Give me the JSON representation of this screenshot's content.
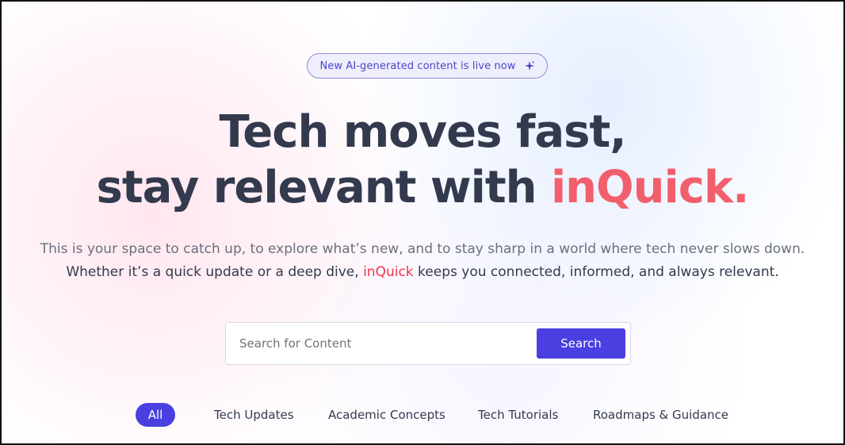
{
  "announcement": {
    "text": "New AI-generated content is live now",
    "icon": "sparkle-icon"
  },
  "hero": {
    "headline_line1": "Tech moves fast,",
    "headline_line2_prefix": "stay relevant with ",
    "headline_brand": "inQuick.",
    "description_line1": "This is your space to catch up, to explore what’s new, and to stay sharp in a world where tech never slows down.",
    "description_line2_prefix": "Whether it’s a quick update or a deep dive, ",
    "description_brand": "inQuick",
    "description_line2_suffix": " keeps you connected, informed, and always relevant."
  },
  "search": {
    "placeholder": "Search for Content",
    "button_label": "Search"
  },
  "categories": {
    "items": [
      {
        "label": "All",
        "active": true
      },
      {
        "label": "Tech Updates",
        "active": false
      },
      {
        "label": "Academic Concepts",
        "active": false
      },
      {
        "label": "Tech Tutorials",
        "active": false
      },
      {
        "label": "Roadmaps & Guidance",
        "active": false
      }
    ]
  },
  "colors": {
    "accent": "#4a3fe0",
    "brand": "#f25f6c",
    "heading": "#333a4d",
    "badge_border": "#8f8bdc",
    "badge_background": "#eeeefd"
  }
}
